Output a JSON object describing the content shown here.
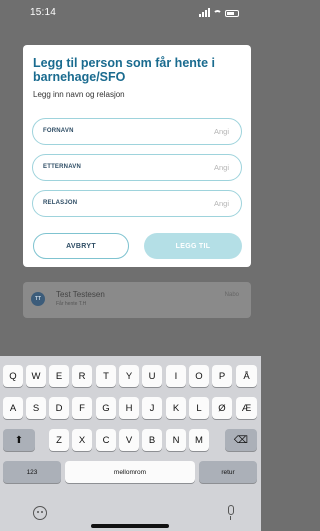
{
  "status_bar": {
    "time": "15:14"
  },
  "modal": {
    "title": "Legg til person som får hente i barnehage/SFO",
    "subtitle": "Legg inn navn og relasjon",
    "fields": [
      {
        "label": "FORNAVN",
        "placeholder": "Angi",
        "value": ""
      },
      {
        "label": "ETTERNAVN",
        "placeholder": "Angi",
        "value": ""
      },
      {
        "label": "RELASJON",
        "placeholder": "Angi",
        "value": ""
      }
    ],
    "cancel_label": "AVBRYT",
    "confirm_label": "LEGG TIL"
  },
  "background_card": {
    "initials": "TT",
    "name": "Test Testesen",
    "subtitle": "Får hente T.H",
    "relation": "Nabo"
  },
  "keyboard": {
    "row1": [
      "Q",
      "W",
      "E",
      "R",
      "T",
      "Y",
      "U",
      "I",
      "O",
      "P",
      "Å"
    ],
    "row2": [
      "A",
      "S",
      "D",
      "F",
      "G",
      "H",
      "J",
      "K",
      "L",
      "Ø",
      "Æ"
    ],
    "row3": [
      "Z",
      "X",
      "C",
      "V",
      "B",
      "N",
      "M"
    ],
    "numbers_label": "123",
    "space_label": "mellomrom",
    "return_label": "retur",
    "shift_symbol": "⬆",
    "backspace_symbol": "⌫"
  },
  "colors": {
    "title": "#1a6b8f",
    "field_border": "#9ed3dc",
    "confirm_button": "#b4dfe6",
    "overlay": "#6f6f6f"
  }
}
